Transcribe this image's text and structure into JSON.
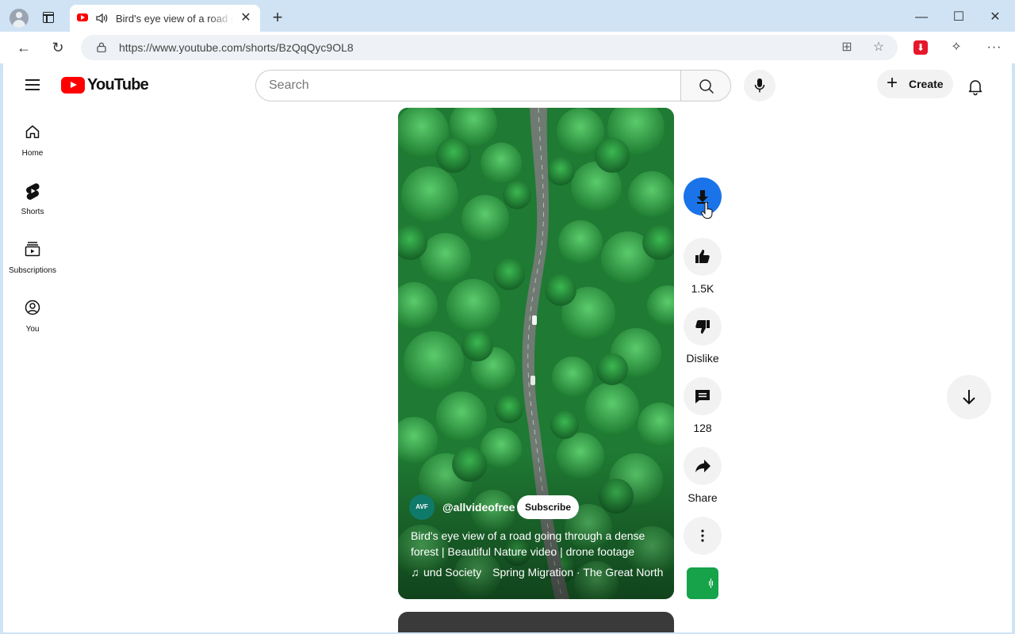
{
  "browser": {
    "tab_title": "Bird's eye view of a road going through a dense forest | Beautiful Nature video | drone footage",
    "url": "https://www.youtube.com/shorts/BzQqQyc9OL8",
    "icons": [
      "profile-icon",
      "tab-actions-icon",
      "youtube-favicon",
      "speaker-icon",
      "close-icon",
      "new-tab-icon",
      "minimize-icon",
      "maximize-icon",
      "close-window-icon",
      "back-icon",
      "refresh-icon",
      "lock-icon",
      "app-available-icon",
      "favorite-star-icon",
      "extension-download-icon",
      "extensions-puzzle-icon",
      "more-menu-icon"
    ]
  },
  "youtube": {
    "logo_text": "YouTube",
    "search_placeholder": "Search",
    "create_label": "Create",
    "sidebar": [
      {
        "label": "Home",
        "icon": "home-icon"
      },
      {
        "label": "Shorts",
        "icon": "shorts-icon"
      },
      {
        "label": "Subscriptions",
        "icon": "subscriptions-icon"
      },
      {
        "label": "You",
        "icon": "you-icon"
      }
    ],
    "short": {
      "channel_handle": "@allvideofree",
      "channel_avatar_text": "AVF",
      "subscribe_label": "Subscribe",
      "title": "Bird's eye view of a road going through a dense forest | Beautiful Nature video | drone footage",
      "music_left": "und Society",
      "music_right": "Spring Migration · The Great North"
    },
    "actions": {
      "likes": "1.5K",
      "dislike_label": "Dislike",
      "comments": "128",
      "share_label": "Share"
    },
    "colors": {
      "brand_red": "#ff0000",
      "download_blue": "#1a73e8",
      "forest_green": "#2e8b3a"
    }
  }
}
